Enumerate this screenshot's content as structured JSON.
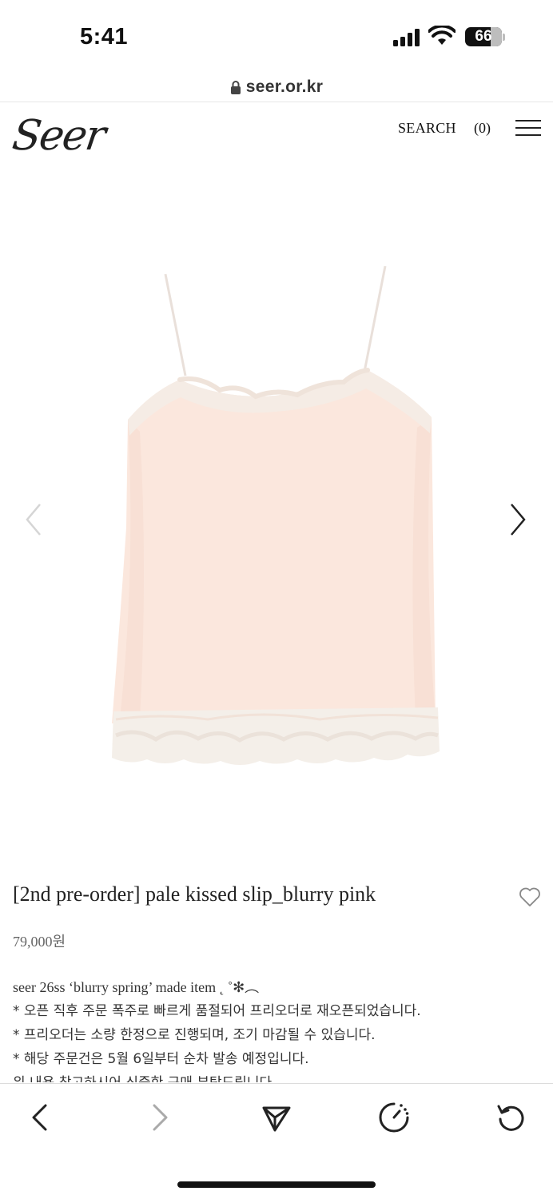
{
  "status_bar": {
    "time": "5:41",
    "battery": "66"
  },
  "browser": {
    "url": "seer.or.kr"
  },
  "site_header": {
    "logo": "Seer",
    "search_label": "SEARCH",
    "cart_label": "(0)"
  },
  "product": {
    "title": "[2nd pre-order] pale kissed slip_blurry pink",
    "price": "79,000원",
    "description": [
      "seer 26ss ‘blurry spring’ made item ˛ ˚✻︵",
      "* 오픈 직후 주문 폭주로 빠르게 품절되어 프리오더로 재오픈되었습니다.",
      "* 프리오더는 소량 한정으로 진행되며, 조기 마감될 수 있습니다.",
      "* 해당 주문건은 5월 6일부터 순차 발송 예정입니다.",
      "위 내용 참고하시어 신중한 구매 부탁드립니다."
    ],
    "image_colors": {
      "fabric": "#fbe6dc",
      "lace": "#f4efe8"
    }
  },
  "toolbar": {
    "icons": [
      "back-icon",
      "forward-icon",
      "share-icon",
      "speed-icon",
      "reload-icon"
    ]
  }
}
